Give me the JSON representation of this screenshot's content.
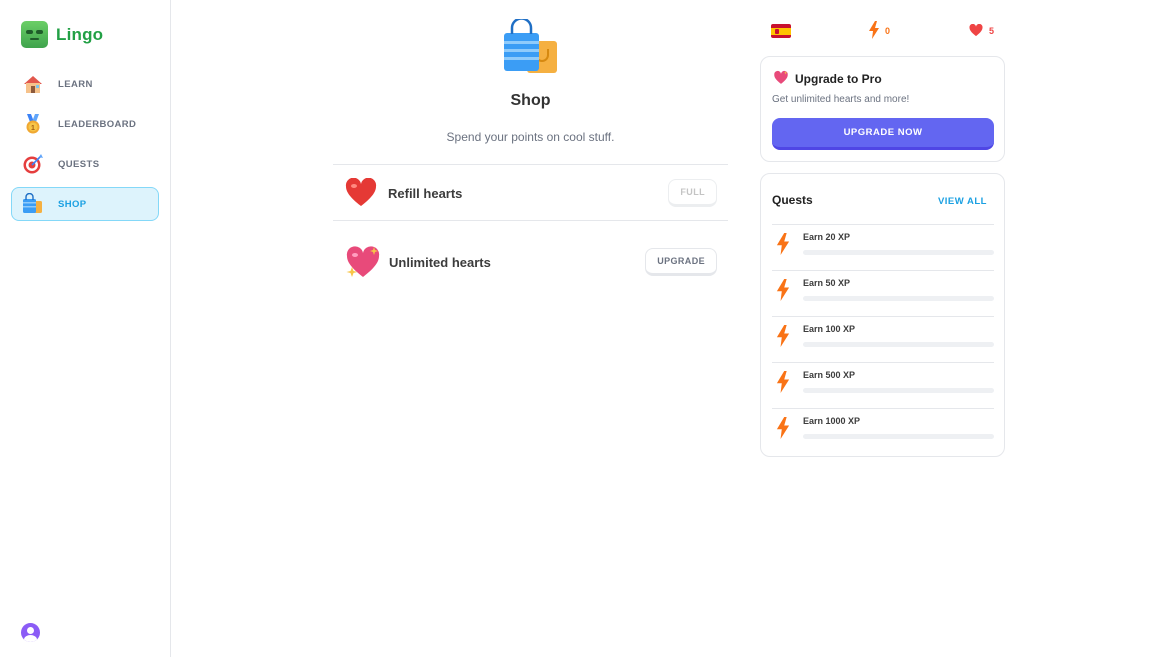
{
  "brand": {
    "name": "Lingo"
  },
  "sidebar": {
    "items": [
      {
        "label": "LEARN",
        "icon": "house-icon",
        "active": false
      },
      {
        "label": "LEADERBOARD",
        "icon": "medal-icon",
        "active": false
      },
      {
        "label": "QUESTS",
        "icon": "target-icon",
        "active": false
      },
      {
        "label": "SHOP",
        "icon": "shopping-bag-icon",
        "active": true
      }
    ]
  },
  "main": {
    "title": "Shop",
    "subtitle": "Spend your points on cool stuff.",
    "items": [
      {
        "label": "Refill hearts",
        "button": "FULL",
        "icon": "heart-icon",
        "button_disabled": true
      },
      {
        "label": "Unlimited hearts",
        "button": "UPGRADE",
        "icon": "sparkling-heart-icon",
        "button_disabled": false
      }
    ]
  },
  "stats": {
    "language": "spain-flag-icon",
    "points": "0",
    "hearts": "5"
  },
  "pro": {
    "title": "Upgrade to Pro",
    "subtitle": "Get unlimited hearts and more!",
    "button": "UPGRADE NOW"
  },
  "quests": {
    "title": "Quests",
    "view_all": "VIEW ALL",
    "items": [
      {
        "label": "Earn 20 XP",
        "progress": 0
      },
      {
        "label": "Earn 50 XP",
        "progress": 0
      },
      {
        "label": "Earn 100 XP",
        "progress": 0
      },
      {
        "label": "Earn 500 XP",
        "progress": 0
      },
      {
        "label": "Earn 1000 XP",
        "progress": 0
      }
    ]
  },
  "colors": {
    "brand": "#22a045",
    "accent": "#1ba0e2",
    "pro_button": "#6366f1",
    "bolt": "#f97316",
    "heart": "#ef4444"
  }
}
